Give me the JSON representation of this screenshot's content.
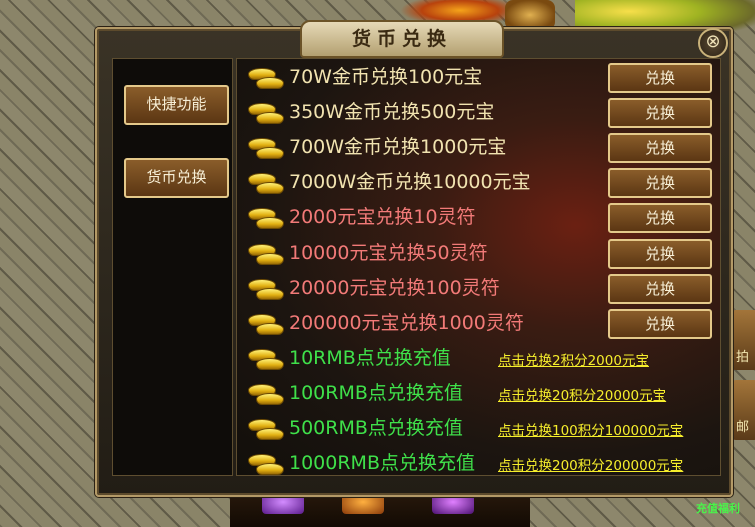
{
  "window": {
    "title": "货币兑换",
    "close_label": "⊗"
  },
  "nav": [
    {
      "label": "快捷功能"
    },
    {
      "label": "货币兑换"
    }
  ],
  "rows": [
    {
      "label": "70W金币兑换100元宝",
      "color": "#f1e3b0",
      "action": "兑换"
    },
    {
      "label": "350W金币兑换500元宝",
      "color": "#f1e3b0",
      "action": "兑换"
    },
    {
      "label": "700W金币兑换1000元宝",
      "color": "#f1e3b0",
      "action": "兑换"
    },
    {
      "label": "7000W金币兑换10000元宝",
      "color": "#f1e3b0",
      "action": "兑换"
    },
    {
      "label": "2000元宝兑换10灵符",
      "color": "#f27a78",
      "action": "兑换"
    },
    {
      "label": "10000元宝兑换50灵符",
      "color": "#f27a78",
      "action": "兑换"
    },
    {
      "label": "20000元宝兑换100灵符",
      "color": "#f27a78",
      "action": "兑换"
    },
    {
      "label": "200000元宝兑换1000灵符",
      "color": "#f27a78",
      "action": "兑换"
    },
    {
      "label": "10RMB点兑换充值",
      "color": "#3fe04a",
      "link": "点击兑换2积分2000元宝"
    },
    {
      "label": "100RMB点兑换充值",
      "color": "#3fe04a",
      "link": "点击兑换20积分20000元宝"
    },
    {
      "label": "500RMB点兑换充值",
      "color": "#3fe04a",
      "link": "点击兑换100积分100000元宝"
    },
    {
      "label": "1000RMB点兑换充值",
      "color": "#3fe04a",
      "link": "点击兑换200积分200000元宝"
    }
  ],
  "side_labels": {
    "right_top": "拍",
    "right_bottom": "邮"
  },
  "footer": {
    "recharge_tip": "充值福利"
  }
}
